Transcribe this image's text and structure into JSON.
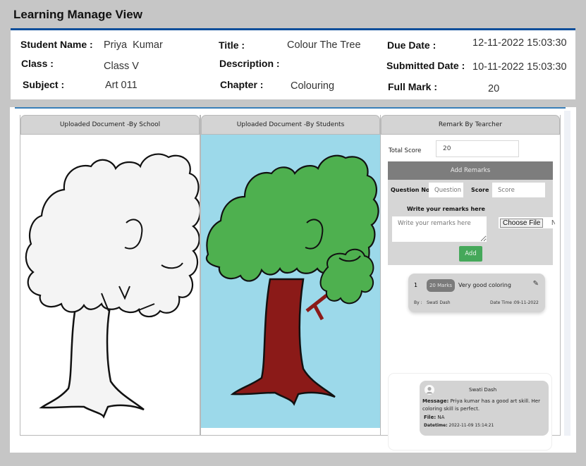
{
  "page": {
    "title": "Learning Manage View"
  },
  "info": {
    "student_name_label": "Student Name :",
    "student_name": "Priya  Kumar",
    "class_label": "Class :",
    "class": "Class V",
    "subject_label": "Subject :",
    "subject": "Art 011",
    "title_label": "Title :",
    "title": "Colour The Tree",
    "description_label": "Description :",
    "description": "",
    "chapter_label": "Chapter :",
    "chapter": "Colouring",
    "due_date_label": "Due Date :",
    "due_date": "12-11-2022 15:03:30",
    "submitted_date_label": "Submitted Date :",
    "submitted_date": "10-11-2022 15:03:30",
    "full_mark_label": "Full Mark :",
    "full_mark": "20"
  },
  "columns": {
    "school_doc": {
      "header": "Uploaded Document -By School",
      "image": "tree-outline-drawing"
    },
    "student_doc": {
      "header": "Uploaded Document -By Students",
      "image": "tree-coloured-drawing"
    },
    "remarks": {
      "header": "Remark By Tearcher",
      "total_score_label": "Total Score",
      "total_score_value": "20",
      "add_remarks_title": "Add Remarks",
      "question_no_label": "Question No",
      "question_no_placeholder": "Question No",
      "score_label": "Score",
      "score_placeholder": "Score",
      "remarks_label": "Write your remarks here",
      "remarks_placeholder": "Write your remarks here",
      "choose_file_label": "Choose File",
      "no_file_label": "No file chosen",
      "add_button": "Add"
    }
  },
  "remark_entries": [
    {
      "index": "1",
      "marks": "20 Marks",
      "text": "Very good coloring",
      "by_label": "By :",
      "by": "Swati Dash",
      "datetime_label": "Date Time :",
      "datetime": "09-11-2022",
      "icon": "edit-icon"
    }
  ],
  "messages": [
    {
      "author": "Swati Dash",
      "message_label": "Message:",
      "message": "Priya kumar has a good art skill. Her coloring skill is perfect.",
      "file_label": "File:",
      "file": "NA",
      "datetime_label": "Datetime:",
      "datetime": "2022-11-09 15:14:21"
    }
  ],
  "colors": {
    "accent": "#0d4e9a",
    "add_button": "#45a85a",
    "sky": "#9cd9ea",
    "foliage": "#4eb04f",
    "trunk": "#8b1a18"
  }
}
